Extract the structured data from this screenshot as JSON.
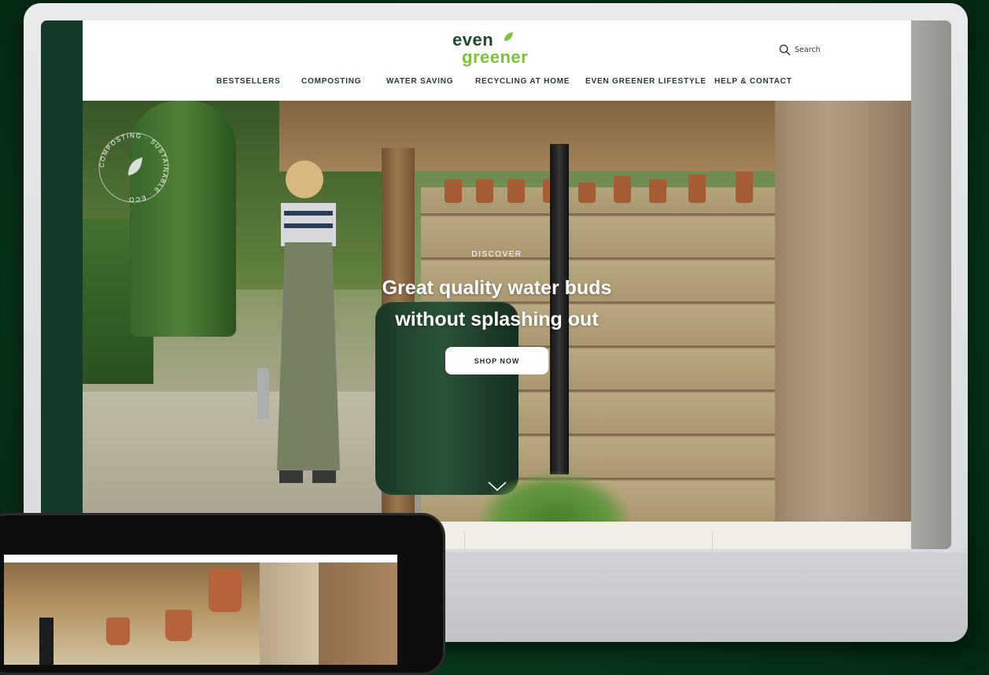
{
  "site": {
    "logo_line1": "even",
    "logo_line2": "greener"
  },
  "header": {
    "search_label": "Search",
    "icons": [
      "search-icon",
      "heart-icon",
      "user-icon",
      "bag-icon"
    ]
  },
  "nav": {
    "items": [
      {
        "label": "BESTSELLERS"
      },
      {
        "label": "COMPOSTING"
      },
      {
        "label": "WATER SAVING"
      },
      {
        "label": "RECYCLING AT HOME"
      },
      {
        "label": "EVEN GREENER LIFESTYLE"
      },
      {
        "label": "HELP & CONTACT"
      }
    ]
  },
  "hero": {
    "badge_text": "COMPOSTING · SUSTAINABLE · ECO",
    "eyebrow": "DISCOVER",
    "headline_line1": "Great quality water buds",
    "headline_line2": "without splashing out",
    "cta_label": "SHOP NOW"
  },
  "colors": {
    "brand_dark": "#1d4a2b",
    "brand_light": "#7cc33a",
    "background": "#083a1d"
  }
}
